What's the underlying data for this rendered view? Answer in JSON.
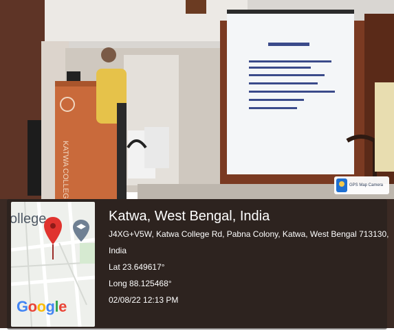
{
  "camera_badge": {
    "label": "GPS Map Camera",
    "icon": "gps-map-camera-icon"
  },
  "map": {
    "place_label": "ollege",
    "logo": "Google",
    "pin_icon": "map-pin-icon",
    "poi_icon": "college-cap-icon"
  },
  "location": {
    "title": "Katwa, West Bengal, India",
    "address_line1": "J4XG+V5W, Katwa College Rd, Pabna Colony, Katwa, West Bengal 713130,",
    "address_line2": "India",
    "lat": "Lat 23.649617°",
    "long": "Long 88.125468°",
    "datetime": "02/08/22 12:13 PM"
  },
  "scene": {
    "podium_text_top": "KATWA",
    "podium_text_bottom": "COLLEGE",
    "slide_title": "সাবর্ণ চৌধুরী?"
  },
  "colors": {
    "overlay": "#231e1c",
    "wall": "#7a3a22",
    "screen": "#f4f6f8",
    "podium": "#c96a3b"
  }
}
